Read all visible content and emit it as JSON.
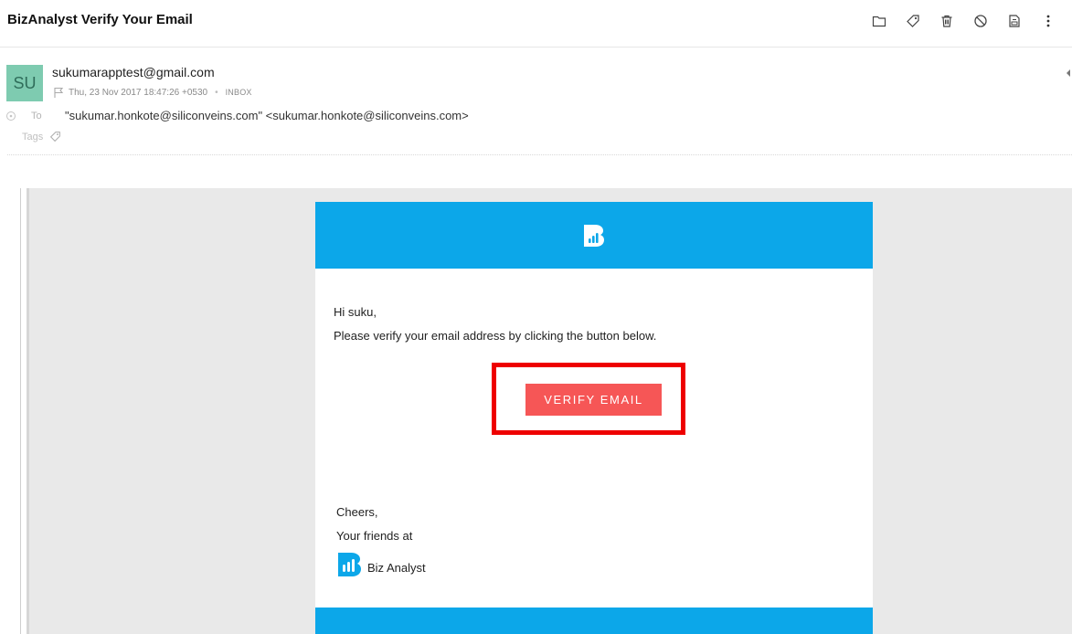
{
  "email": {
    "subject": "BizAnalyst Verify Your Email",
    "toolbar": [
      "folder-icon",
      "tag-icon",
      "trash-icon",
      "block-icon",
      "print-icon",
      "more-icon"
    ],
    "avatar_initials": "SU",
    "from": "sukumarapptest@gmail.com",
    "date": "Thu, 23 Nov 2017 18:47:26 +0530",
    "folder": "INBOX",
    "to_label": "To",
    "to_value": "\"sukumar.honkote@siliconveins.com\" <sukumar.honkote@siliconveins.com>",
    "tags_label": "Tags"
  },
  "body": {
    "greeting": "Hi suku,",
    "message": "Please verify your email address by clicking the button below.",
    "button_label": "VERIFY EMAIL",
    "cheers": "Cheers,",
    "friends": "Your friends at",
    "brand_name": "Biz Analyst"
  },
  "colors": {
    "brand_blue": "#0ca7e9",
    "button_red": "#f65656",
    "highlight_red": "#ee0000",
    "avatar_green": "#7ecbb0"
  }
}
